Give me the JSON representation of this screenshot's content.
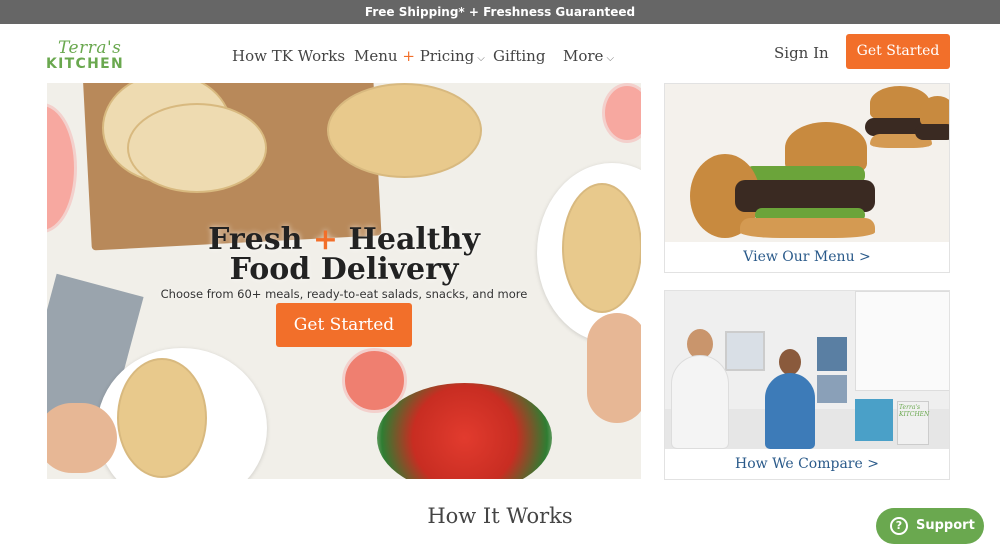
{
  "promo": {
    "text": "Free Shipping* + Freshness Guaranteed"
  },
  "logo": {
    "script": "Terra's",
    "caps": "KITCHEN"
  },
  "nav": {
    "how": "How TK Works",
    "menu_a": "Menu",
    "menu_plus": "+",
    "menu_b": "Pricing",
    "gifting": "Gifting",
    "more": "More"
  },
  "header": {
    "sign_in": "Sign In",
    "cta": "Get Started"
  },
  "hero": {
    "title_a": "Fresh",
    "title_plus": "+",
    "title_b": "Healthy",
    "title_line2": "Food Delivery",
    "subtitle": "Choose from 60+ meals, ready-to-eat salads, snacks, and more",
    "cta": "Get Started"
  },
  "cards": {
    "menu_link": "View Our Menu >",
    "compare_link": "How We Compare >",
    "compare_sign": "Terra's KITCHEN"
  },
  "section": {
    "title": "How It Works"
  },
  "support": {
    "label": "Support",
    "icon_glyph": "?"
  },
  "colors": {
    "accent": "#f26f2a",
    "brand_green": "#6aa84f",
    "promo_bg": "#666666",
    "link_blue": "#2a5a8a"
  }
}
